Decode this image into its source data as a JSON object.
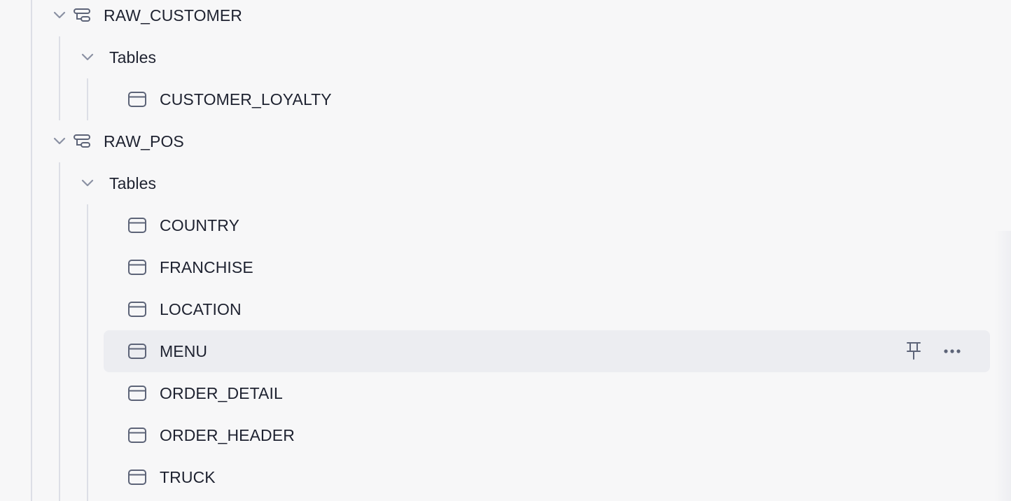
{
  "tree": {
    "schemas": [
      {
        "name": "RAW_CUSTOMER",
        "icon": "schema-icon",
        "expanded": true,
        "groups": [
          {
            "label": "Tables",
            "expanded": true,
            "tables": [
              "CUSTOMER_LOYALTY"
            ]
          }
        ]
      },
      {
        "name": "RAW_POS",
        "icon": "schema-icon",
        "expanded": true,
        "groups": [
          {
            "label": "Tables",
            "expanded": true,
            "tables": [
              "COUNTRY",
              "FRANCHISE",
              "LOCATION",
              "MENU",
              "ORDER_DETAIL",
              "ORDER_HEADER",
              "TRUCK"
            ]
          }
        ]
      }
    ],
    "hovered_table": "MENU",
    "hover_actions": [
      "pin-icon",
      "more-options-icon"
    ]
  },
  "colors": {
    "background": "#f7f7f8",
    "text": "#1e2230",
    "icon": "#5d6478",
    "guide_line": "#dddfe6",
    "hover_row": "#ecedf1"
  }
}
